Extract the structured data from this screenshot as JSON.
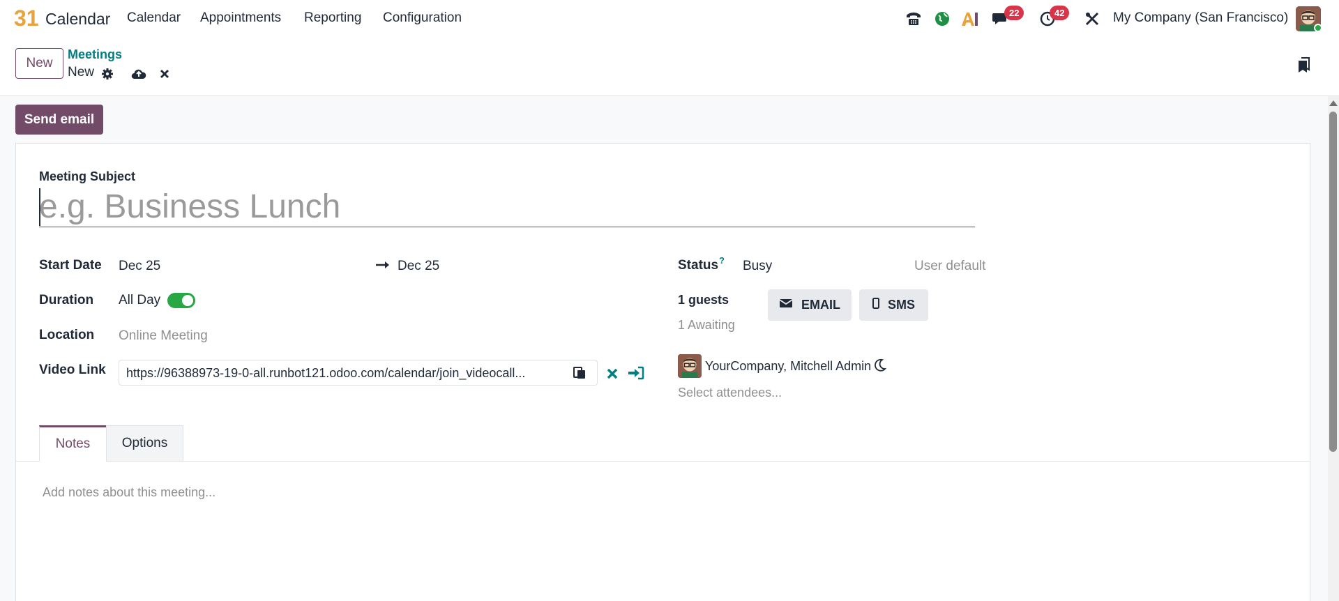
{
  "navbar": {
    "app_logo_text": "31",
    "app_name": "Calendar",
    "menus": [
      "Calendar",
      "Appointments",
      "Reporting",
      "Configuration"
    ],
    "messages_badge": "22",
    "activities_badge": "42",
    "company": "My Company (San Francisco)",
    "icons": [
      "phone-icon",
      "globe-icon",
      "ai-icon",
      "chat-icon",
      "clock-icon",
      "tools-icon"
    ]
  },
  "control": {
    "new_button": "New",
    "breadcrumb": "Meetings",
    "record_name": "New"
  },
  "form": {
    "send_email_button": "Send email",
    "subject_label": "Meeting Subject",
    "subject_placeholder": "e.g. Business Lunch",
    "start_date_label": "Start Date",
    "start_date": "Dec 25",
    "end_date": "Dec 25",
    "duration_label": "Duration",
    "all_day_label": "All Day",
    "all_day": true,
    "location_label": "Location",
    "location_placeholder": "Online Meeting",
    "video_link_label": "Video Link",
    "video_link": "https://96388973-19-0-all.runbot121.odoo.com/calendar/join_videocall...",
    "status_label": "Status",
    "status_help": "?",
    "status_value": "Busy",
    "status_placeholder": "User default",
    "guests_count": "1 guests",
    "awaiting": "1 Awaiting",
    "email_button": "EMAIL",
    "sms_button": "SMS",
    "attendee_name": "YourCompany, Mitchell Admin",
    "attendees_placeholder": "Select attendees..."
  },
  "tabs": {
    "notes": "Notes",
    "options": "Options",
    "notes_placeholder": "Add notes about this meeting..."
  },
  "colors": {
    "brand": "#714b67",
    "link": "#017e84",
    "toggle_on": "#28a745",
    "badge": "#d9354a"
  }
}
